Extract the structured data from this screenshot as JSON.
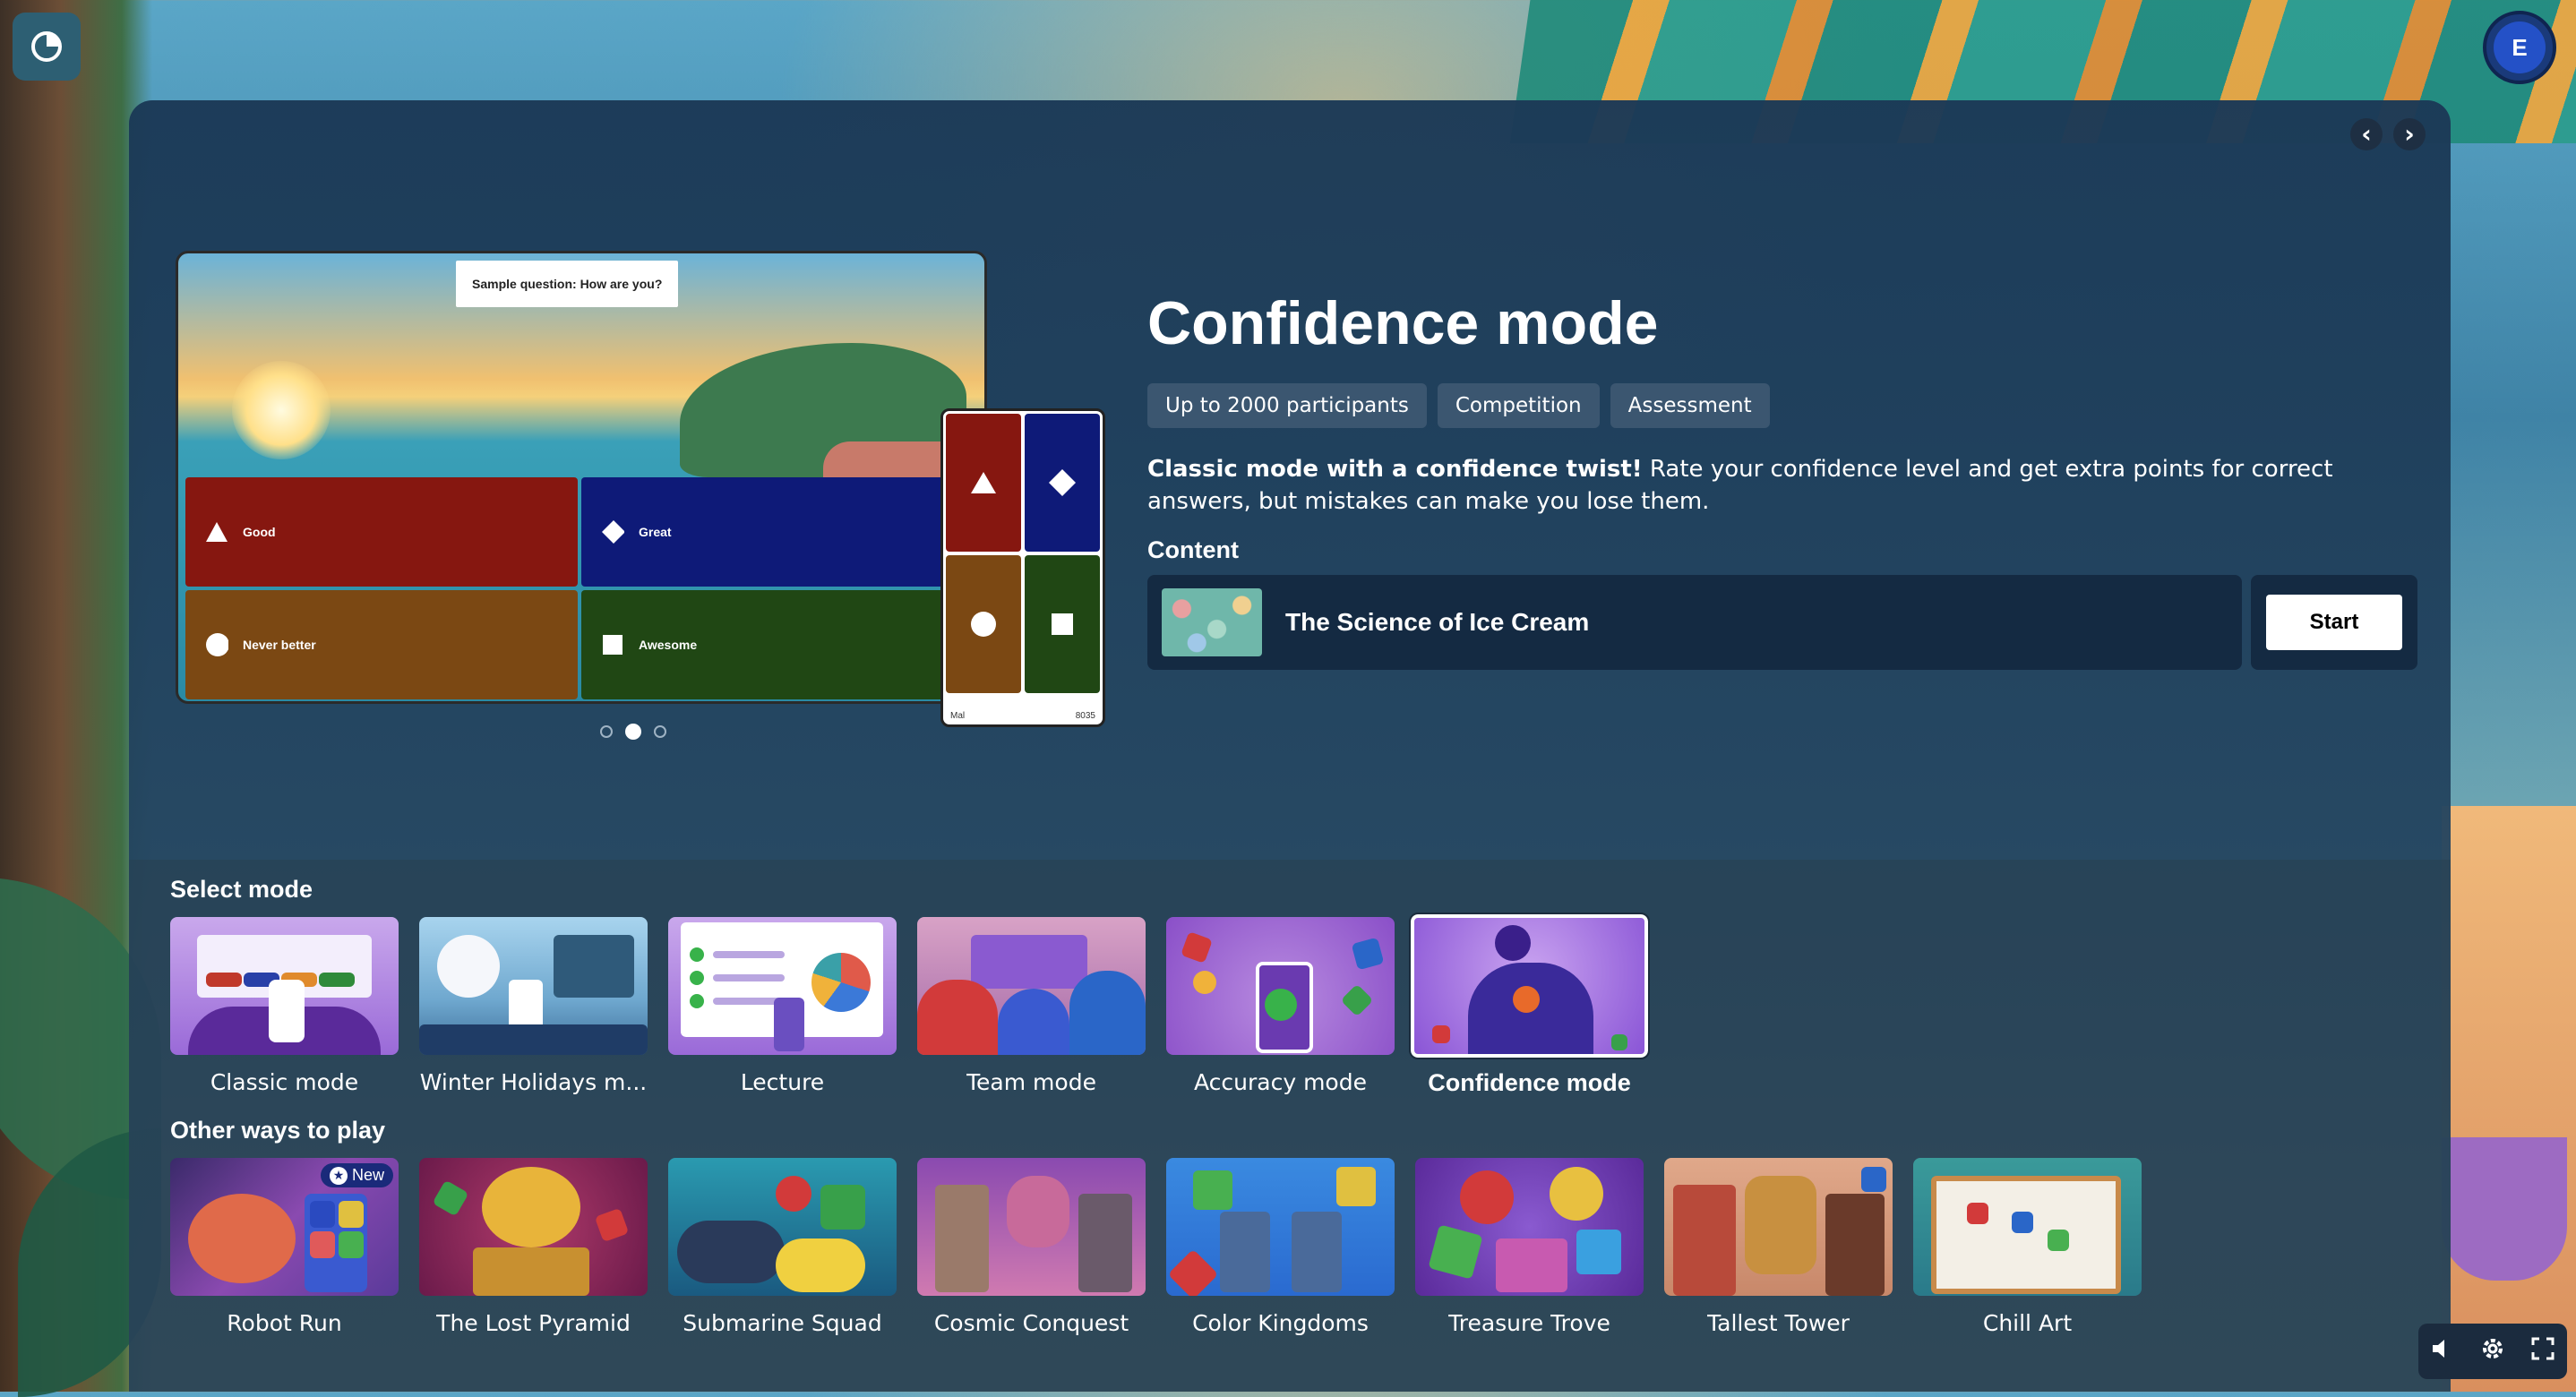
{
  "user": {
    "avatar_initial": "E"
  },
  "mode": {
    "title": "Confidence mode",
    "tags": [
      "Up to 2000 participants",
      "Competition",
      "Assessment"
    ],
    "description_bold": "Classic mode with a confidence twist!",
    "description_rest": " Rate your confidence level and get extra points for correct answers, but mistakes can make you lose them."
  },
  "preview": {
    "question": "Sample question: How are you?",
    "answers": [
      "Good",
      "Great",
      "Never better",
      "Awesome"
    ],
    "phone_player": "Mal",
    "phone_score": "8035",
    "slides_total": 3,
    "slide_active": 2
  },
  "content": {
    "label": "Content",
    "title": "The Science of Ice Cream",
    "start_label": "Start"
  },
  "select_mode": {
    "label": "Select mode",
    "modes": [
      {
        "label": "Classic mode",
        "selected": false
      },
      {
        "label": "Winter Holidays m...",
        "selected": false
      },
      {
        "label": "Lecture",
        "selected": false
      },
      {
        "label": "Team mode",
        "selected": false
      },
      {
        "label": "Accuracy mode",
        "selected": false
      },
      {
        "label": "Confidence mode",
        "selected": true
      }
    ]
  },
  "other_ways": {
    "label": "Other ways to play",
    "games": [
      {
        "label": "Robot Run",
        "badge": "New"
      },
      {
        "label": "The Lost Pyramid"
      },
      {
        "label": "Submarine Squad"
      },
      {
        "label": "Cosmic Conquest"
      },
      {
        "label": "Color Kingdoms"
      },
      {
        "label": "Treasure Trove"
      },
      {
        "label": "Tallest Tower"
      },
      {
        "label": "Chill Art"
      }
    ]
  },
  "icons": {
    "corner": "spinner-icon",
    "nav_prev": "chevron-left-icon",
    "nav_next": "chevron-right-icon",
    "volume": "volume-icon",
    "settings": "gear-icon",
    "fullscreen": "fullscreen-icon"
  },
  "colors": {
    "answer_red": "#861710",
    "answer_blue": "#0e1a78",
    "answer_orange": "#7b4813",
    "answer_green": "#204714"
  }
}
